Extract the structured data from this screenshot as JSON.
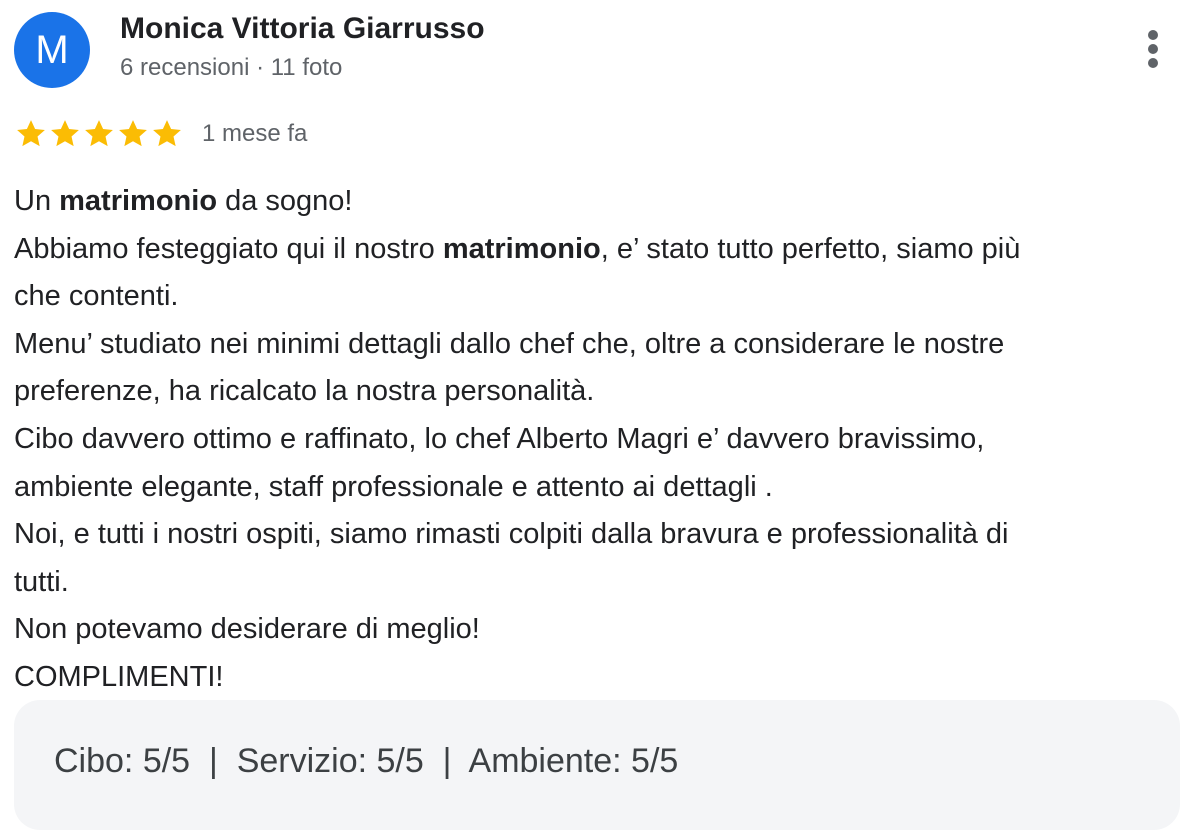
{
  "author": {
    "initial": "M",
    "name": "Monica Vittoria Giarrusso",
    "meta": "6 recensioni · 11 foto",
    "avatar_color": "#1a73e8"
  },
  "rating": {
    "stars": 5,
    "max_stars": 5,
    "star_color": "#fbbc04",
    "date": "1 mese fa"
  },
  "review": {
    "lines": [
      [
        {
          "t": "Un ",
          "b": false
        },
        {
          "t": "matrimonio",
          "b": true
        },
        {
          "t": " da sogno!",
          "b": false
        }
      ],
      [
        {
          "t": "Abbiamo festeggiato qui il nostro ",
          "b": false
        },
        {
          "t": "matrimonio",
          "b": true
        },
        {
          "t": ", e’ stato tutto perfetto, siamo più",
          "b": false
        }
      ],
      [
        {
          "t": "che contenti.",
          "b": false
        }
      ],
      [
        {
          "t": "Menu’ studiato nei minimi dettagli dallo chef che, oltre a considerare le nostre",
          "b": false
        }
      ],
      [
        {
          "t": "preferenze, ha ricalcato la nostra personalità.",
          "b": false
        }
      ],
      [
        {
          "t": "Cibo davvero ottimo e raffinato, lo chef Alberto Magri e’ davvero bravissimo,",
          "b": false
        }
      ],
      [
        {
          "t": "ambiente elegante, staff professionale e attento ai dettagli .",
          "b": false
        }
      ],
      [
        {
          "t": "Noi, e tutti i nostri ospiti, siamo rimasti colpiti dalla bravura e professionalità di",
          "b": false
        }
      ],
      [
        {
          "t": "tutti.",
          "b": false
        }
      ],
      [
        {
          "t": "Non potevamo desiderare di meglio!",
          "b": false
        }
      ],
      [
        {
          "t": "COMPLIMENTI!",
          "b": false
        }
      ]
    ]
  },
  "sub_ratings": {
    "text": "Cibo: 5/5  |  Servizio: 5/5  |  Ambiente: 5/5",
    "items": [
      {
        "label": "Cibo",
        "value": "5/5"
      },
      {
        "label": "Servizio",
        "value": "5/5"
      },
      {
        "label": "Ambiente",
        "value": "5/5"
      }
    ]
  },
  "icons": {
    "more": "more-vert-icon",
    "star": "star-icon"
  }
}
